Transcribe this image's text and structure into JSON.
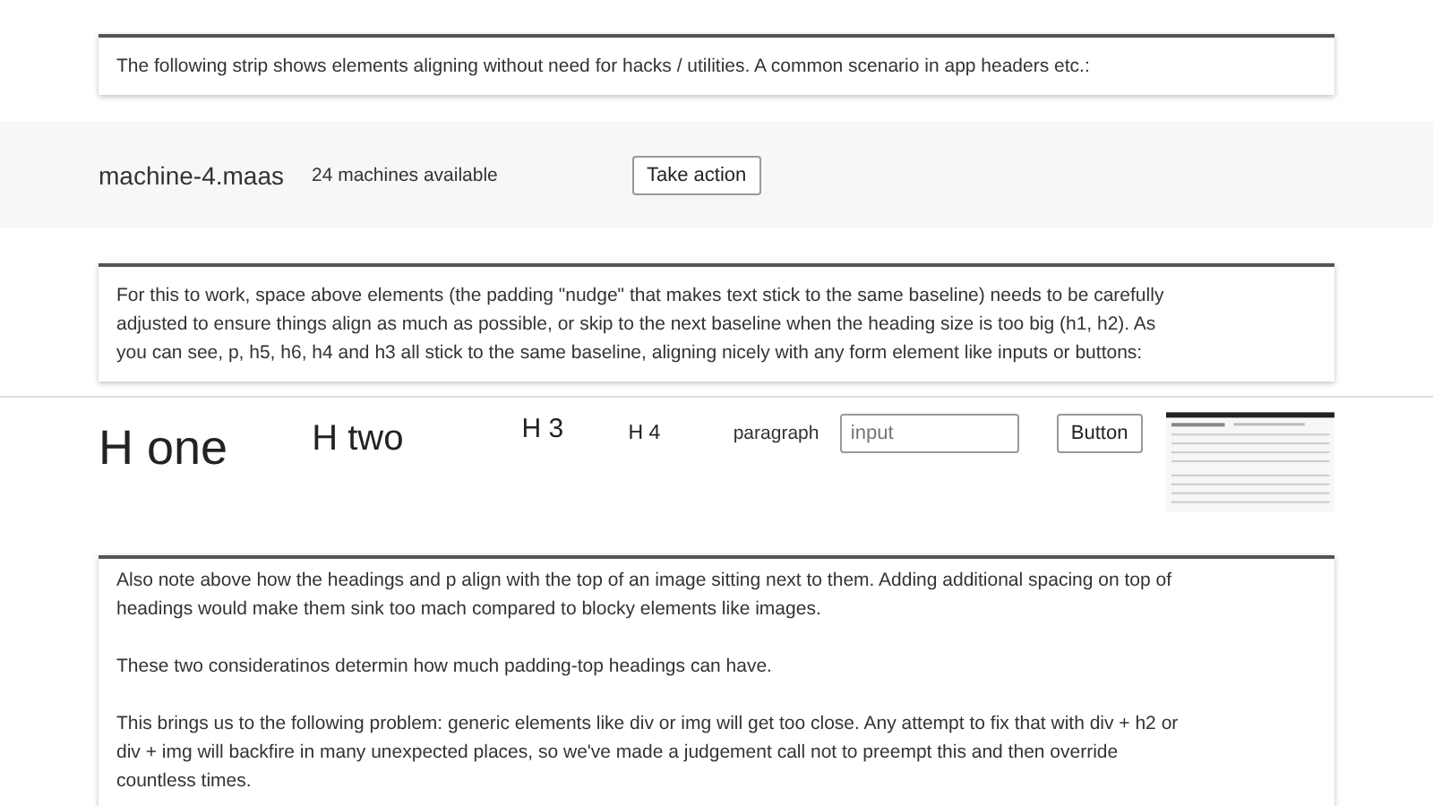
{
  "intro": {
    "text": "The following strip shows elements aligning without need for hacks / utilities. A common scenario in app headers etc.:"
  },
  "header_strip": {
    "title": "machine-4.maas",
    "count": "24 machines available",
    "action_button": "Take action"
  },
  "explanation": {
    "text": "For this to work, space above elements (the padding \"nudge\" that makes text stick to the same baseline) needs to be carefully adjusted to ensure things align as much as possible, or skip to the next baseline when the heading size is too big (h1, h2). As you can see, p, h5, h6, h4 and h3 all stick to the same baseline, aligning nicely with any form element like inputs or buttons:"
  },
  "demo_row": [
    {
      "kind": "h1",
      "text": "H one"
    },
    {
      "kind": "h2",
      "text": "H two"
    },
    {
      "kind": "h3",
      "text": "H 3"
    },
    {
      "kind": "h4",
      "text": "H 4"
    },
    {
      "kind": "p",
      "text": "paragraph"
    },
    {
      "kind": "input",
      "placeholder": "input"
    },
    {
      "kind": "button",
      "text": "Button"
    },
    {
      "kind": "image"
    }
  ],
  "notes": {
    "paragraphs": [
      "Also note above how the headings and p align with the top of an image sitting next to them. Adding additional spacing on top of headings would make them sink too mach compared to blocky elements like images.",
      "These two consideratinos determin how much padding-top headings can have.",
      "This brings us to the following problem: generic elements like div or img will get too close. Any attempt to fix that with div + h2 or div + img will backfire in many unexpected places, so we've made a judgement call not to preempt this and then override countless times."
    ]
  }
}
